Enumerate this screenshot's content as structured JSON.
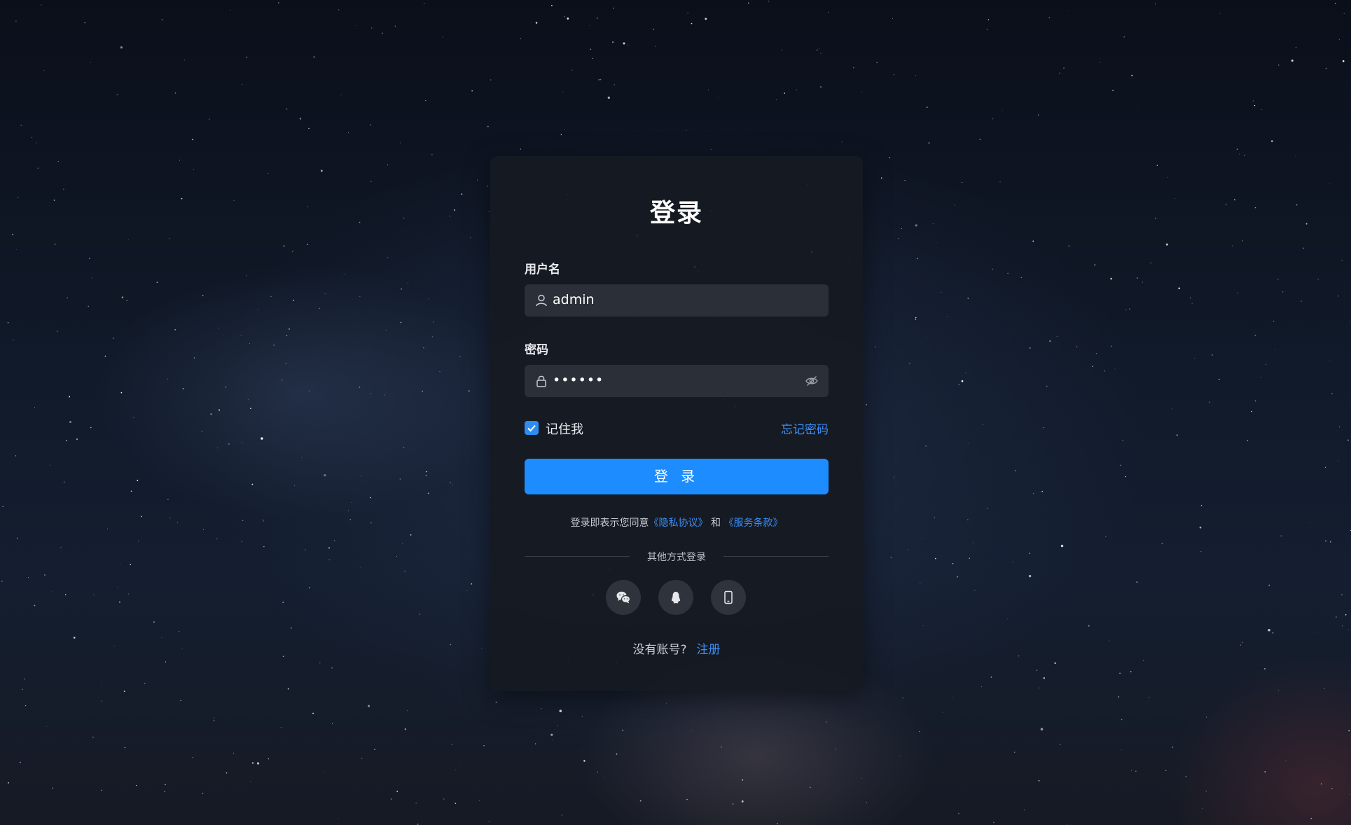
{
  "login": {
    "title": "登录",
    "username_label": "用户名",
    "username_value": "admin",
    "password_label": "密码",
    "password_value": "••••••",
    "remember_label": "记住我",
    "remember_checked": true,
    "forgot_label": "忘记密码",
    "submit_label": "登 录",
    "agreement_prefix": "登录即表示您同意",
    "privacy_link": "《隐私协议》",
    "agreement_and": "和",
    "terms_link": "《服务条款》",
    "other_methods_label": "其他方式登录",
    "no_account_label": "没有账号?",
    "register_label": "注册"
  },
  "social": [
    {
      "icon": "wechat-icon"
    },
    {
      "icon": "qq-icon"
    },
    {
      "icon": "mobile-icon"
    }
  ],
  "colors": {
    "accent": "#1c8cff",
    "link": "#3d8ff5",
    "card": "#16191f",
    "input": "#2b2f37"
  }
}
